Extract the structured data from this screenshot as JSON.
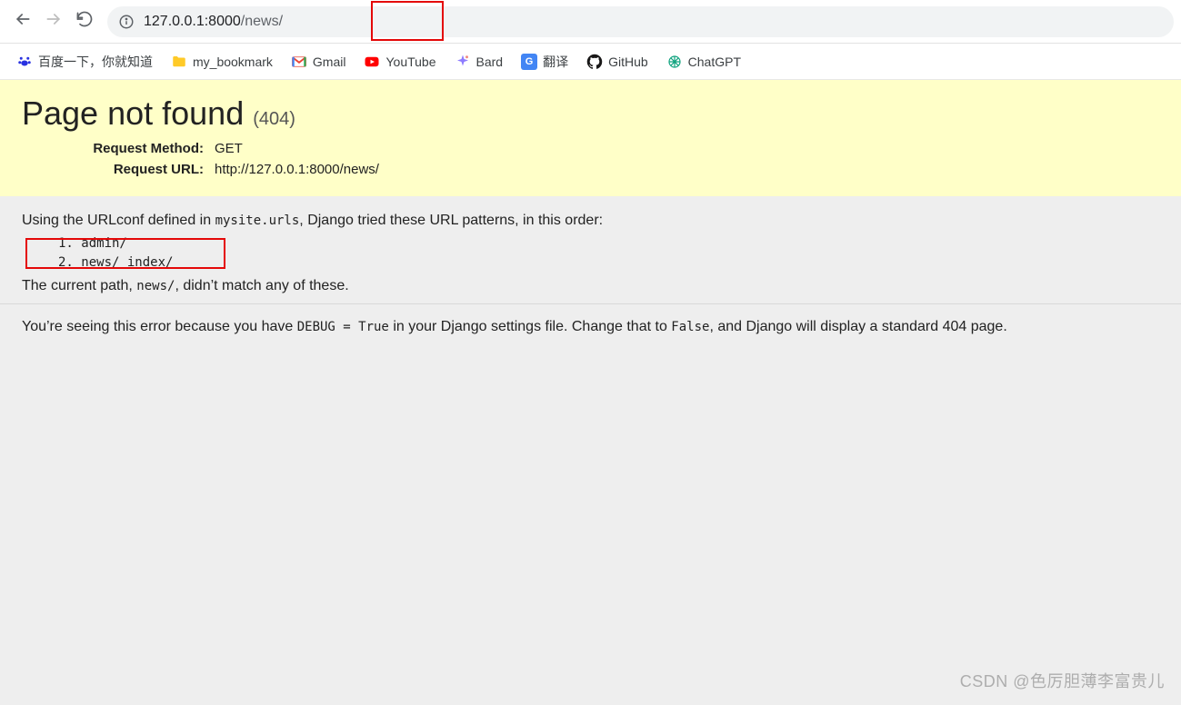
{
  "nav": {
    "url_host": "127.0.0.1:8000",
    "url_path": "/news/"
  },
  "bookmarks": [
    {
      "label": "百度一下，你就知道",
      "icon": "baidu"
    },
    {
      "label": "my_bookmark",
      "icon": "folder"
    },
    {
      "label": "Gmail",
      "icon": "gmail"
    },
    {
      "label": "YouTube",
      "icon": "youtube"
    },
    {
      "label": "Bard",
      "icon": "bard"
    },
    {
      "label": "翻译",
      "icon": "gtranslate"
    },
    {
      "label": "GitHub",
      "icon": "github"
    },
    {
      "label": "ChatGPT",
      "icon": "chatgpt"
    }
  ],
  "error": {
    "title": "Page not found ",
    "status": "(404)",
    "request_method_label": "Request Method:",
    "request_method": "GET",
    "request_url_label": "Request URL:",
    "request_url": "http://127.0.0.1:8000/news/",
    "intro_pre": "Using the URLconf defined in ",
    "intro_conf": "mysite.urls",
    "intro_post": ", Django tried these URL patterns, in this order:",
    "patterns": [
      "1. admin/",
      "2. news/ index/"
    ],
    "nomatch_pre": "The current path, ",
    "nomatch_path": "news/",
    "nomatch_post": ", didn’t match any of these.",
    "explain_pre": "You’re seeing this error because you have ",
    "explain_debug": "DEBUG = True",
    "explain_mid": " in your Django settings file. Change that to ",
    "explain_false": "False",
    "explain_post": ", and Django will display a standard 404 page."
  },
  "watermark": "CSDN @色厉胆薄李富贵儿"
}
